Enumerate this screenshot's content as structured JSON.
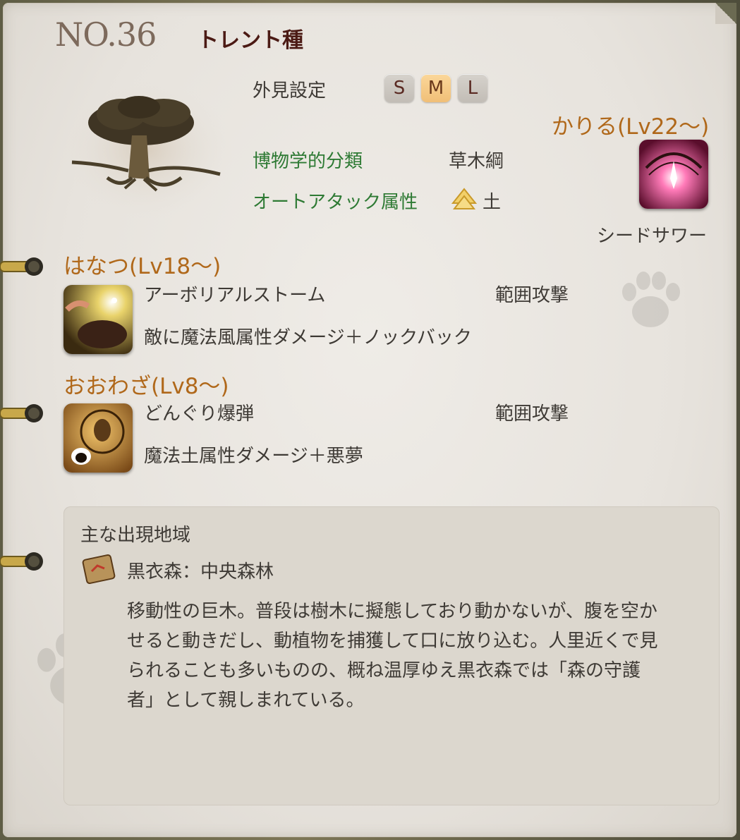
{
  "header": {
    "number": "NO.36",
    "species": "トレント種"
  },
  "appearance": {
    "label": "外見設定",
    "sizes": [
      "S",
      "M",
      "L"
    ],
    "selected": "M"
  },
  "classification": {
    "label": "博物学的分類",
    "value": "草木綱"
  },
  "auto_attack": {
    "label": "オートアタック属性",
    "value": "土",
    "icon": "earth-element-icon"
  },
  "kariru": {
    "title": "かりる(Lv22～)",
    "skill_name": "シードサワー",
    "icon": "seed-shower-icon"
  },
  "hanatsu": {
    "title": "はなつ(Lv18～)",
    "skill_name": "アーボリアルストーム",
    "type": "範囲攻撃",
    "description": "敵に魔法風属性ダメージ＋ノックバック",
    "icon": "arboreal-storm-icon"
  },
  "oowaza": {
    "title": "おおわざ(Lv8～)",
    "skill_name": "どんぐり爆弾",
    "type": "範囲攻撃",
    "description": "魔法土属性ダメージ＋悪夢",
    "icon": "acorn-bomb-icon"
  },
  "habitat": {
    "label": "主な出現地域",
    "location": "黒衣森：中央森林",
    "description_lines": [
      "移動性の巨木。普段は樹木に擬態しており動かないが、腹を空か",
      "せると動きだし、動植物を捕獲して口に放り込む。人里近くで見",
      "られることも多いものの、概ね温厚ゆえ黒衣森では「森の守護",
      "者」として親しまれている。"
    ]
  },
  "colors": {
    "section_title": "#b0681a",
    "green_label": "#2e7a34",
    "species": "#4b1a14",
    "active_size": "#f0bf77"
  }
}
